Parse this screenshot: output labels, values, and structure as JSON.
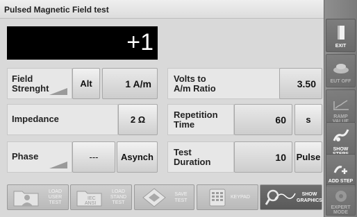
{
  "title": "Pulsed Magnetic Field test",
  "display": {
    "value": "+1"
  },
  "field_strength": {
    "label_line1": "Field",
    "label_line2": "Strenght",
    "mode": "Alt",
    "value": "1 A/m"
  },
  "volts_ratio": {
    "label_line1": "Volts to",
    "label_line2": "A/m Ratio",
    "value": "3.50"
  },
  "impedance": {
    "label": "Impedance",
    "value": "2 Ω"
  },
  "repetition": {
    "label_line1": "Repetition",
    "label_line2": "Time",
    "value": "60",
    "unit": "s"
  },
  "phase": {
    "label": "Phase",
    "value": "---",
    "mode": "Asynch"
  },
  "test_duration": {
    "label_line1": "Test",
    "label_line2": "Duration",
    "value": "10",
    "unit": "Pulse"
  },
  "bottom": {
    "load_user": {
      "l1": "LOAD",
      "l2": "USER",
      "l3": "TEST"
    },
    "load_standard": {
      "l1": "LOAD",
      "l2": "STAND",
      "l3": "TEST",
      "icon_text1": "IEC",
      "icon_text2": "ANSI"
    },
    "save": {
      "l1": "SAVE",
      "l2": "TEST"
    },
    "keypad": {
      "label": "KEYPAD"
    },
    "show_graphics": {
      "l1": "SHOW",
      "l2": "GRAPHICS"
    }
  },
  "sidebar": {
    "exit": "EXIT",
    "eut_off": "EUT OFF",
    "ramp_value": "RAMP VALUE",
    "show_steps": "SHOW STEPS",
    "add_step": "ADD STEP",
    "expert_mode_l1": "EXPERT",
    "expert_mode_l2": "MODE"
  },
  "colors": {
    "accent_display_bg": "#000000",
    "sidebar_bg": "#7f7f7f",
    "panel_bg": "#d9d9d9"
  }
}
